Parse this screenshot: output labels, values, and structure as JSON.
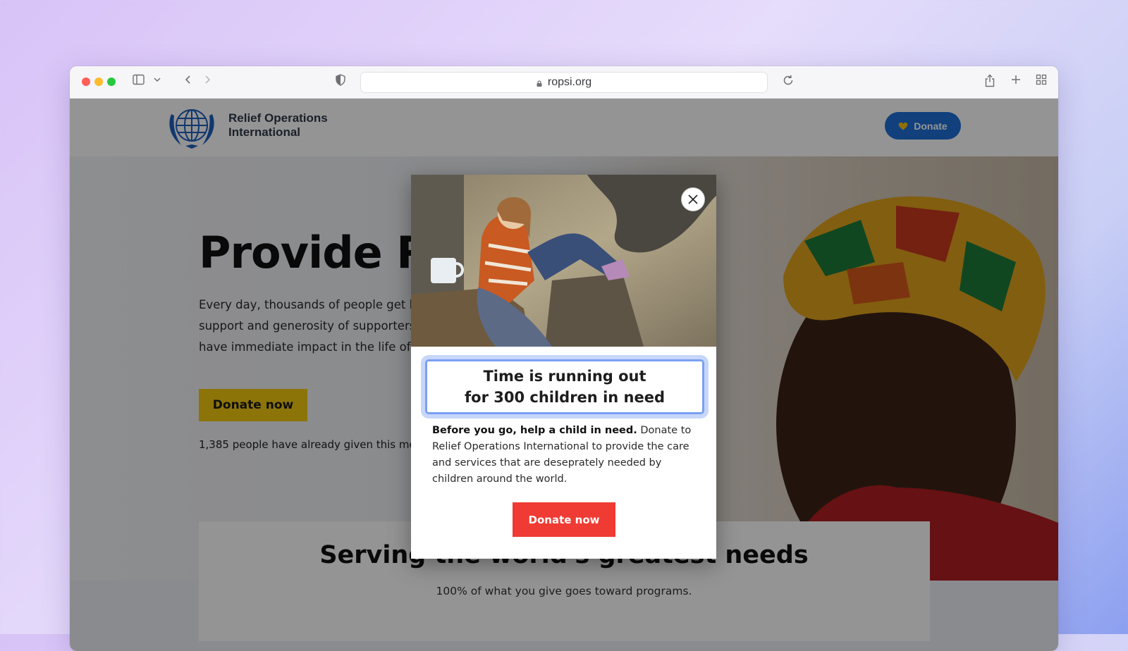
{
  "browser": {
    "url": "ropsi.org",
    "traffic_lights": {
      "close": "#fe5f57",
      "minimize": "#febc2e",
      "zoom": "#28c840"
    }
  },
  "site": {
    "org_name_line1": "Relief Operations",
    "org_name_line2": "International",
    "header_donate_label": "Donate",
    "brand_color": "#1e6fd6"
  },
  "hero": {
    "title": "Provide R",
    "text_line1": "Every day, thousands of people get he",
    "text_line2": "support and generosity of supporters",
    "text_line3": "have immediate impact in the life of s",
    "donate_label": "Donate now",
    "donor_count_text": "1,385 people have already given this mon",
    "button_color": "#f2c80f"
  },
  "section": {
    "title": "Serving the world's greatest needs",
    "subtitle": "100% of what you give goes toward programs."
  },
  "modal": {
    "headline_line1": "Time is running out",
    "headline_line2": "for 300 children in need",
    "body_bold": "Before you go, help a child in need.",
    "body_rest": " Donate to Relief Operations International to provide the care and services that are deseprately needed by children around the world.",
    "donate_label": "Donate now",
    "donate_color": "#ef3b33"
  }
}
